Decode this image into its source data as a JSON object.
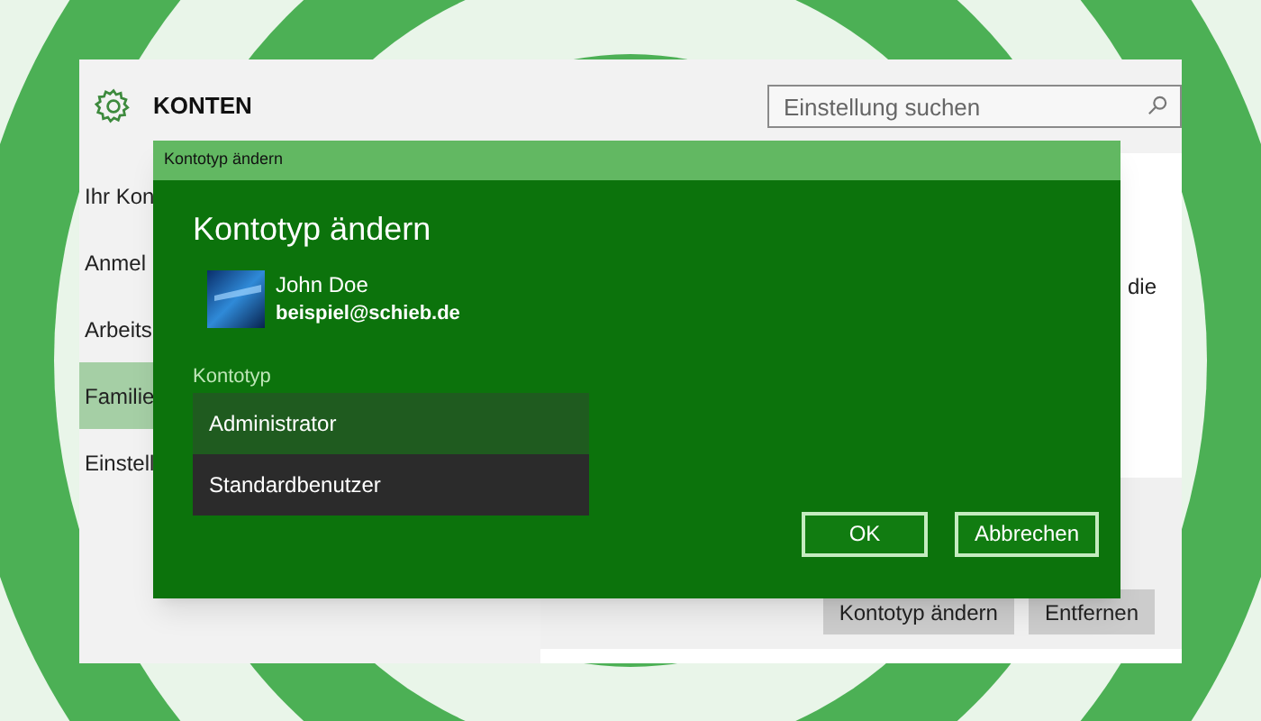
{
  "window": {
    "title": "KONTEN"
  },
  "search": {
    "placeholder": "Einstellung suchen"
  },
  "sidebar": {
    "items": [
      {
        "label": "Ihr Kon",
        "selected": false
      },
      {
        "label": "Anmel",
        "selected": false
      },
      {
        "label": "Arbeits",
        "selected": false
      },
      {
        "label": "Familie",
        "selected": true
      },
      {
        "label": "Einstell",
        "selected": false
      }
    ]
  },
  "content": {
    "text_fragment": "die",
    "buttons": [
      "Kontotyp ändern",
      "Entfernen"
    ]
  },
  "dialog": {
    "titlebar": "Kontotyp ändern",
    "heading": "Kontotyp ändern",
    "user": {
      "name": "John Doe",
      "email": "beispiel@schieb.de"
    },
    "field_label": "Kontotyp",
    "options": [
      {
        "label": "Administrator",
        "selected": true
      },
      {
        "label": "Standardbenutzer",
        "selected": false
      }
    ],
    "buttons": [
      "OK",
      "Abbrechen"
    ]
  }
}
